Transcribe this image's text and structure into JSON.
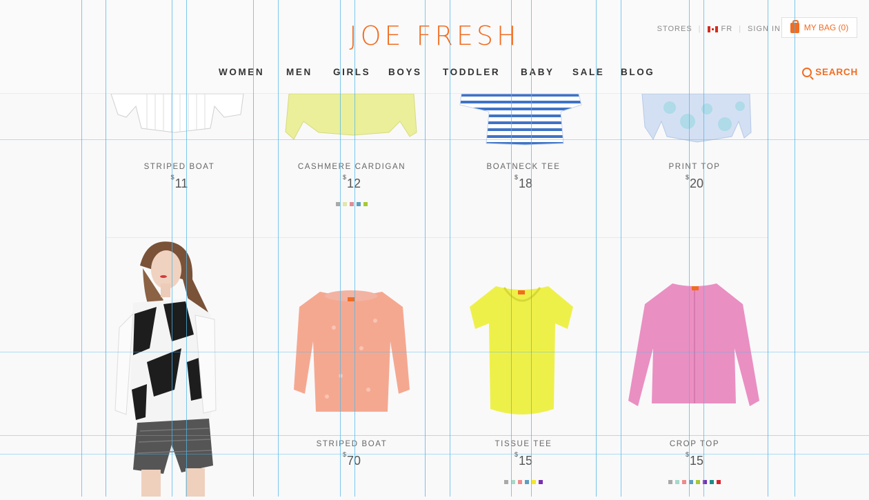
{
  "header": {
    "logo": "JOE FRESH",
    "stores": "STORES",
    "lang": "FR",
    "sign_in": "SIGN IN",
    "bag": "MY BAG (0)",
    "search": "SEARCH"
  },
  "nav": [
    "WOMEN",
    "MEN",
    "GIRLS",
    "BOYS",
    "TODDLER",
    "BABY",
    "SALE",
    "BLOG"
  ],
  "row1": [
    {
      "name": "STRIPED BOAT",
      "currency": "$",
      "price": "11",
      "swatches": []
    },
    {
      "name": "CASHMERE CARDIGAN",
      "currency": "$",
      "price": "12",
      "swatches": [
        "#a9a9a9",
        "#e2e6a8",
        "#df8f92",
        "#5ba0c2",
        "#a6c934"
      ]
    },
    {
      "name": "BOATNECK TEE",
      "currency": "$",
      "price": "18",
      "swatches": []
    },
    {
      "name": "PRINT TOP",
      "currency": "$",
      "price": "20",
      "swatches": []
    }
  ],
  "row2": [
    {
      "name": "STRIPED BOAT",
      "currency": "$",
      "price": "70",
      "swatches": []
    },
    {
      "name": "TISSUE TEE",
      "currency": "$",
      "price": "15",
      "swatches": [
        "#a9a9a9",
        "#a6d9c9",
        "#f08a8c",
        "#5b9fc2",
        "#f3e62a",
        "#7a2fb0"
      ]
    },
    {
      "name": "CROP TOP",
      "currency": "$",
      "price": "15",
      "swatches": [
        "#a9a9a9",
        "#a6d9c9",
        "#f08a8c",
        "#5b9fc2",
        "#a6c934",
        "#7a2fb0",
        "#1c8c8a",
        "#d8262c"
      ]
    }
  ],
  "colors": {
    "brand": "#f26c21",
    "guide": "#4fb7e8"
  },
  "icons": [
    "canada-flag-icon",
    "shopping-bag-icon",
    "search-icon"
  ]
}
